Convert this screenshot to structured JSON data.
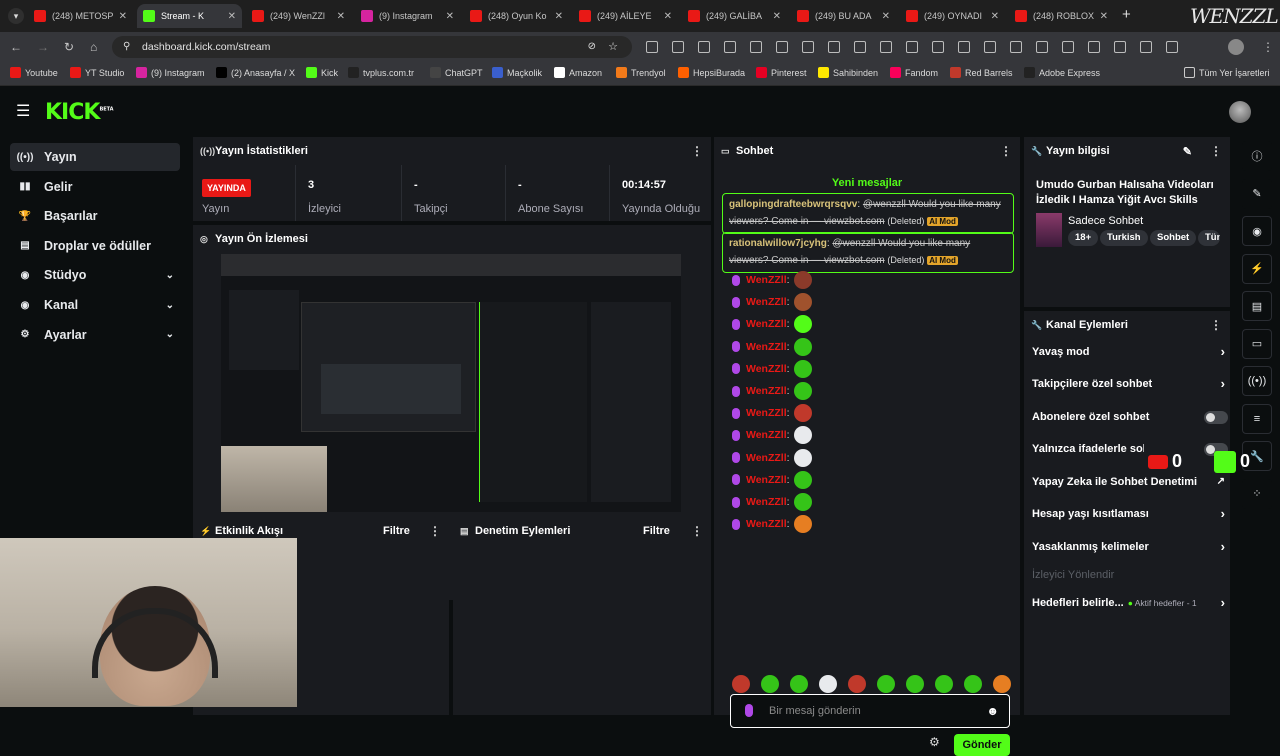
{
  "browser": {
    "tabs": [
      {
        "title": "(248) METOSP",
        "color": "#e91916",
        "icon": "youtube-icon",
        "active": false
      },
      {
        "title": "Stream - K",
        "color": "#53fc18",
        "icon": "kick-icon",
        "active": true
      },
      {
        "title": "(249) WenZZl",
        "color": "#e91916",
        "icon": "youtube-icon",
        "active": false
      },
      {
        "title": "(9) Instagram",
        "color": "#d6249f",
        "icon": "instagram-icon",
        "active": false
      },
      {
        "title": "(248) Oyun Ko",
        "color": "#e91916",
        "icon": "youtube-icon",
        "active": false
      },
      {
        "title": "(249) AİLEYE",
        "color": "#e91916",
        "icon": "youtube-icon",
        "active": false
      },
      {
        "title": "(249) GALİBA",
        "color": "#e91916",
        "icon": "youtube-icon",
        "active": false
      },
      {
        "title": "(249) BU ADA",
        "color": "#e91916",
        "icon": "youtube-icon",
        "active": false
      },
      {
        "title": "(249) OYNADI",
        "color": "#e91916",
        "icon": "youtube-icon",
        "active": false
      },
      {
        "title": "(248) ROBLOX",
        "color": "#e91916",
        "icon": "youtube-icon",
        "active": false
      }
    ],
    "url": "dashboard.kick.com/stream",
    "bookmarks": [
      {
        "label": "Youtube",
        "color": "#e91916"
      },
      {
        "label": "YT Studio",
        "color": "#e91916"
      },
      {
        "label": "(9) Instagram",
        "color": "#d6249f"
      },
      {
        "label": "(2) Anasayfa / X",
        "color": "#000000"
      },
      {
        "label": "Kick",
        "color": "#53fc18"
      },
      {
        "label": "tvplus.com.tr",
        "color": "#222222"
      },
      {
        "label": "ChatGPT",
        "color": "#444444"
      },
      {
        "label": "Maçkolik",
        "color": "#3a5fcd"
      },
      {
        "label": "Amazon",
        "color": "#ffffff"
      },
      {
        "label": "Trendyol",
        "color": "#f27a1a"
      },
      {
        "label": "HepsiBurada",
        "color": "#ff6000"
      },
      {
        "label": "Pinterest",
        "color": "#e60023"
      },
      {
        "label": "Sahibinden",
        "color": "#ffe800"
      },
      {
        "label": "Fandom",
        "color": "#fa005a"
      },
      {
        "label": "Red Barrels",
        "color": "#c0392b"
      },
      {
        "label": "Adobe Express",
        "color": "#222222"
      }
    ],
    "all_bookmarks": "Tüm Yer İşaretleri",
    "watermark": "WENZZL"
  },
  "app": {
    "logo": "KICK",
    "logo_badge": "BETA",
    "accent": "#53fc18",
    "sidebar": [
      {
        "label": "Yayın",
        "icon": "broadcast-icon",
        "active": true,
        "expand": false
      },
      {
        "label": "Gelir",
        "icon": "chart-icon",
        "active": false,
        "expand": false
      },
      {
        "label": "Başarılar",
        "icon": "trophy-icon",
        "active": false,
        "expand": false
      },
      {
        "label": "Droplar ve ödüller",
        "icon": "gift-icon",
        "active": false,
        "expand": false
      },
      {
        "label": "Stüdyo",
        "icon": "studio-icon",
        "active": false,
        "expand": true
      },
      {
        "label": "Kanal",
        "icon": "channel-icon",
        "active": false,
        "expand": true
      },
      {
        "label": "Ayarlar",
        "icon": "settings-icon",
        "active": false,
        "expand": true
      }
    ],
    "stats": {
      "title": "Yayın İstatistikleri",
      "live_badge": "YAYINDA",
      "items": [
        {
          "value": "",
          "label": "Yayın"
        },
        {
          "value": "3",
          "label": "İzleyici"
        },
        {
          "value": "-",
          "label": "Takipçi"
        },
        {
          "value": "-",
          "label": "Abone Sayısı"
        },
        {
          "value": "00:14:57",
          "label": "Yayında Olduğu"
        }
      ]
    },
    "preview": {
      "title": "Yayın Ön İzlemesi"
    },
    "activity": {
      "title": "Etkinlik Akışı",
      "filter": "Filtre"
    },
    "moderation": {
      "title": "Denetim Eylemleri",
      "filter": "Filtre"
    },
    "chat": {
      "title": "Sohbet",
      "new_messages": "Yeni mesajlar",
      "deleted_messages": [
        {
          "user": "gallopingdrafteebwrqrsqvv",
          "text": "@wenzzll Would you like many viewers? Come in — viewzbot.com",
          "deleted": "(Deleted)",
          "tag": "AI Mod"
        },
        {
          "user": "rationalwillow7jcyhg",
          "text": "@wenzzll Would you like many viewers? Come in — viewzbot.com",
          "deleted": "(Deleted)",
          "tag": "AI Mod"
        }
      ],
      "messages": [
        {
          "user": "WenZZll",
          "emote_color": "#8b3a2a"
        },
        {
          "user": "WenZZll",
          "emote_color": "#a0522d"
        },
        {
          "user": "WenZZll",
          "emote_color": "#53fc18"
        },
        {
          "user": "WenZZll",
          "emote_color": "#35c418"
        },
        {
          "user": "WenZZll",
          "emote_color": "#35c418"
        },
        {
          "user": "WenZZll",
          "emote_color": "#35c418"
        },
        {
          "user": "WenZZll",
          "emote_color": "#c0392b"
        },
        {
          "user": "WenZZll",
          "emote_color": "#e8eaed"
        },
        {
          "user": "WenZZll",
          "emote_color": "#e8eaed"
        },
        {
          "user": "WenZZll",
          "emote_color": "#35c418"
        },
        {
          "user": "WenZZll",
          "emote_color": "#35c418"
        },
        {
          "user": "WenZZll",
          "emote_color": "#e67e22"
        }
      ],
      "placeholder": "Bir mesaj gönderin",
      "send": "Gönder"
    },
    "stream_info": {
      "title": "Yayın bilgisi",
      "stream_title": "Umudo Gurban Halısaha Videoları İzledik I Hamza Yiğit Avcı Skills",
      "category": "Sadece Sohbet",
      "chips": [
        "18+",
        "Turkish",
        "Sohbet",
        "Tür"
      ]
    },
    "channel_actions": {
      "title": "Kanal Eylemleri",
      "items": [
        {
          "label": "Yavaş mod",
          "control": "arrow"
        },
        {
          "label": "Takipçilere özel sohbet",
          "control": "arrow"
        },
        {
          "label": "Abonelere özel sohbet",
          "control": "toggle"
        },
        {
          "label": "Yalnızca ifadelerle sohbet",
          "control": "toggle"
        },
        {
          "label": "Yapay Zeka ile Sohbet Denetimi",
          "control": "external"
        },
        {
          "label": "Hesap yaşı kısıtlaması",
          "control": "arrow"
        },
        {
          "label": "Yasaklanmış kelimeler",
          "control": "arrow"
        },
        {
          "label": "İzleyici Yönlendir",
          "control": "none"
        },
        {
          "label": "Hedefleri belirle...",
          "control": "arrow",
          "extra": "Aktif hedefler - 1"
        }
      ]
    },
    "overlay_digits": [
      "0",
      "0"
    ]
  }
}
